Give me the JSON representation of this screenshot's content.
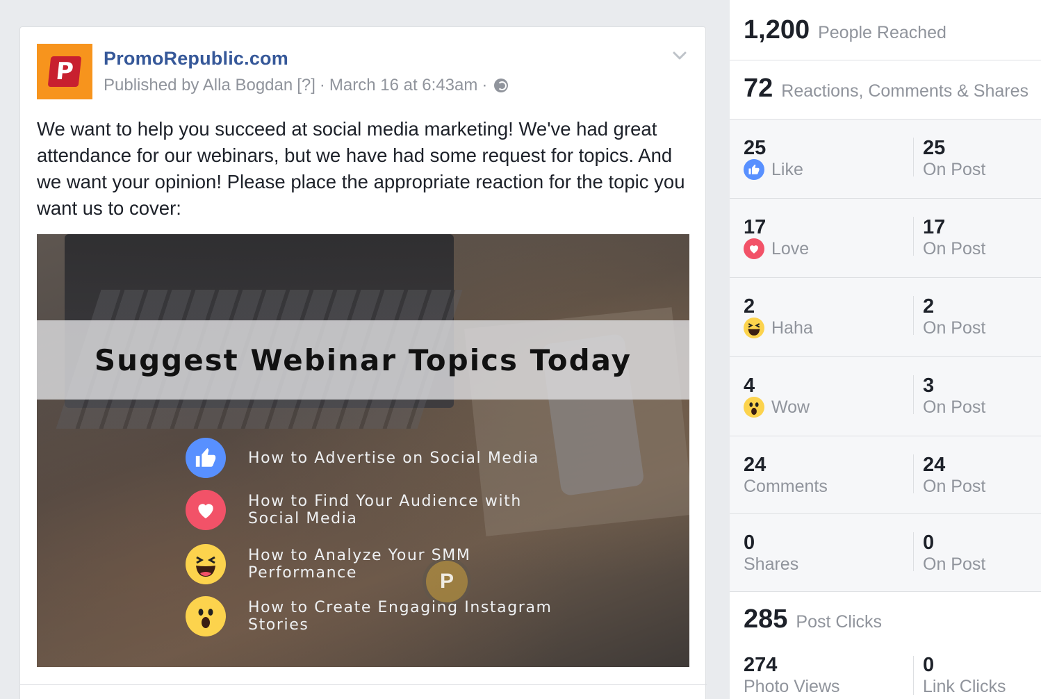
{
  "post": {
    "page_name": "PromoRepublic.com",
    "logo_letter": "P",
    "published_by": "Published by Alla Bogdan",
    "help": "[?]",
    "separator": "·",
    "date": "March 16 at 6:43am",
    "text": "We want to help you succeed at social media marketing! We've had great attendance for our webinars, but we have had some request for topics. And we want your opinion! Please place the appropriate reaction for the topic you want us to cover:",
    "image": {
      "banner_title": "Suggest Webinar Topics Today",
      "watermark_letter": "P",
      "topics": [
        {
          "icon": "like-icon",
          "text": "How to Advertise on Social Media"
        },
        {
          "icon": "love-icon",
          "text": "How to Find Your Audience with Social Media"
        },
        {
          "icon": "haha-icon",
          "text": "How to Analyze Your SMM Performance"
        },
        {
          "icon": "wow-icon",
          "text": "How to Create Engaging Instagram Stories"
        }
      ]
    }
  },
  "insights": {
    "people_reached": {
      "value": "1,200",
      "label": "People Reached"
    },
    "engagement": {
      "value": "72",
      "label": "Reactions, Comments & Shares"
    },
    "rows": [
      {
        "left_value": "25",
        "left_label": "Like",
        "icon": "like-icon",
        "right_value": "25",
        "right_label": "On Post"
      },
      {
        "left_value": "17",
        "left_label": "Love",
        "icon": "love-icon",
        "right_value": "17",
        "right_label": "On Post"
      },
      {
        "left_value": "2",
        "left_label": "Haha",
        "icon": "haha-icon",
        "right_value": "2",
        "right_label": "On Post"
      },
      {
        "left_value": "4",
        "left_label": "Wow",
        "icon": "wow-icon",
        "right_value": "3",
        "right_label": "On Post"
      },
      {
        "left_value": "24",
        "left_label": "Comments",
        "right_value": "24",
        "right_label": "On Post"
      },
      {
        "left_value": "0",
        "left_label": "Shares",
        "right_value": "0",
        "right_label": "On Post"
      }
    ],
    "post_clicks": {
      "value": "285",
      "label": "Post Clicks"
    },
    "clicks_row": {
      "left_value": "274",
      "left_label": "Photo Views",
      "right_value": "0",
      "right_label": "Link Clicks"
    }
  },
  "colors": {
    "link": "#365899",
    "muted": "#90949c",
    "text": "#1d2129",
    "like": "#5890ff",
    "love": "#f25268",
    "haha_wow": "#fcd34d"
  }
}
